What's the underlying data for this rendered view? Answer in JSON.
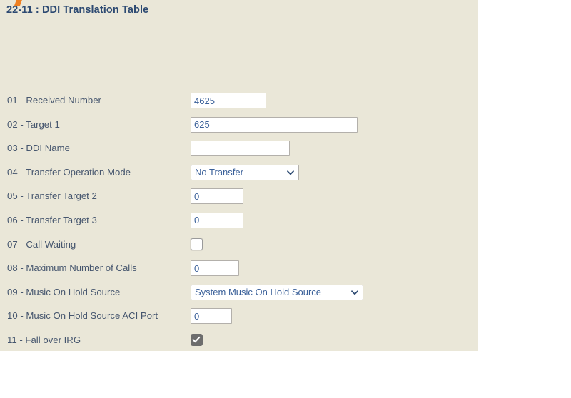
{
  "page": {
    "title": "22-11 : DDI Translation Table",
    "logo_icon": "orange-slash-logo-icon",
    "panel_color": "#eae7d8",
    "title_color": "#2d4a72",
    "label_color": "#46566e",
    "value_color": "#3a6099",
    "accent_color": "#ef8022"
  },
  "form": {
    "rows": [
      {
        "label": "01 - Received Number",
        "control": "text",
        "value": "4625",
        "placeholder": "",
        "name": "received-number-input",
        "width_class": "w-rcv"
      },
      {
        "label": "02 - Target 1",
        "control": "text",
        "value": "625",
        "placeholder": "",
        "name": "target-1-input",
        "width_class": "w-tgt1"
      },
      {
        "label": "03 - DDI Name",
        "control": "text",
        "value": "",
        "placeholder": "",
        "name": "ddi-name-input",
        "width_class": "w-name"
      },
      {
        "label": "04 - Transfer Operation Mode",
        "control": "select",
        "value": "No Transfer",
        "name": "transfer-operation-mode-select",
        "width_class": "w-transfer"
      },
      {
        "label": "05 - Transfer Target 2",
        "control": "text",
        "value": "0",
        "placeholder": "",
        "name": "transfer-target-2-input",
        "width_class": "w-small"
      },
      {
        "label": "06 - Transfer Target 3",
        "control": "text",
        "value": "0",
        "placeholder": "",
        "name": "transfer-target-3-input",
        "width_class": "w-small"
      },
      {
        "label": "07 - Call Waiting",
        "control": "checkbox",
        "checked": false,
        "name": "call-waiting-checkbox"
      },
      {
        "label": "08 - Maximum Number of Calls",
        "control": "text",
        "value": "0",
        "placeholder": "",
        "name": "maximum-number-of-calls-input",
        "width_class": "w-calls"
      },
      {
        "label": "09 - Music On Hold Source",
        "control": "select",
        "value": "System Music On Hold Source",
        "name": "music-on-hold-source-select",
        "width_class": "w-moh"
      },
      {
        "label": "10 - Music On Hold Source ACI Port",
        "control": "text",
        "value": "0",
        "placeholder": "",
        "name": "music-on-hold-source-aci-port-input",
        "width_class": "w-aci"
      },
      {
        "label": "11 - Fall over IRG",
        "control": "checkbox",
        "checked": true,
        "name": "fall-over-irg-checkbox"
      }
    ]
  }
}
